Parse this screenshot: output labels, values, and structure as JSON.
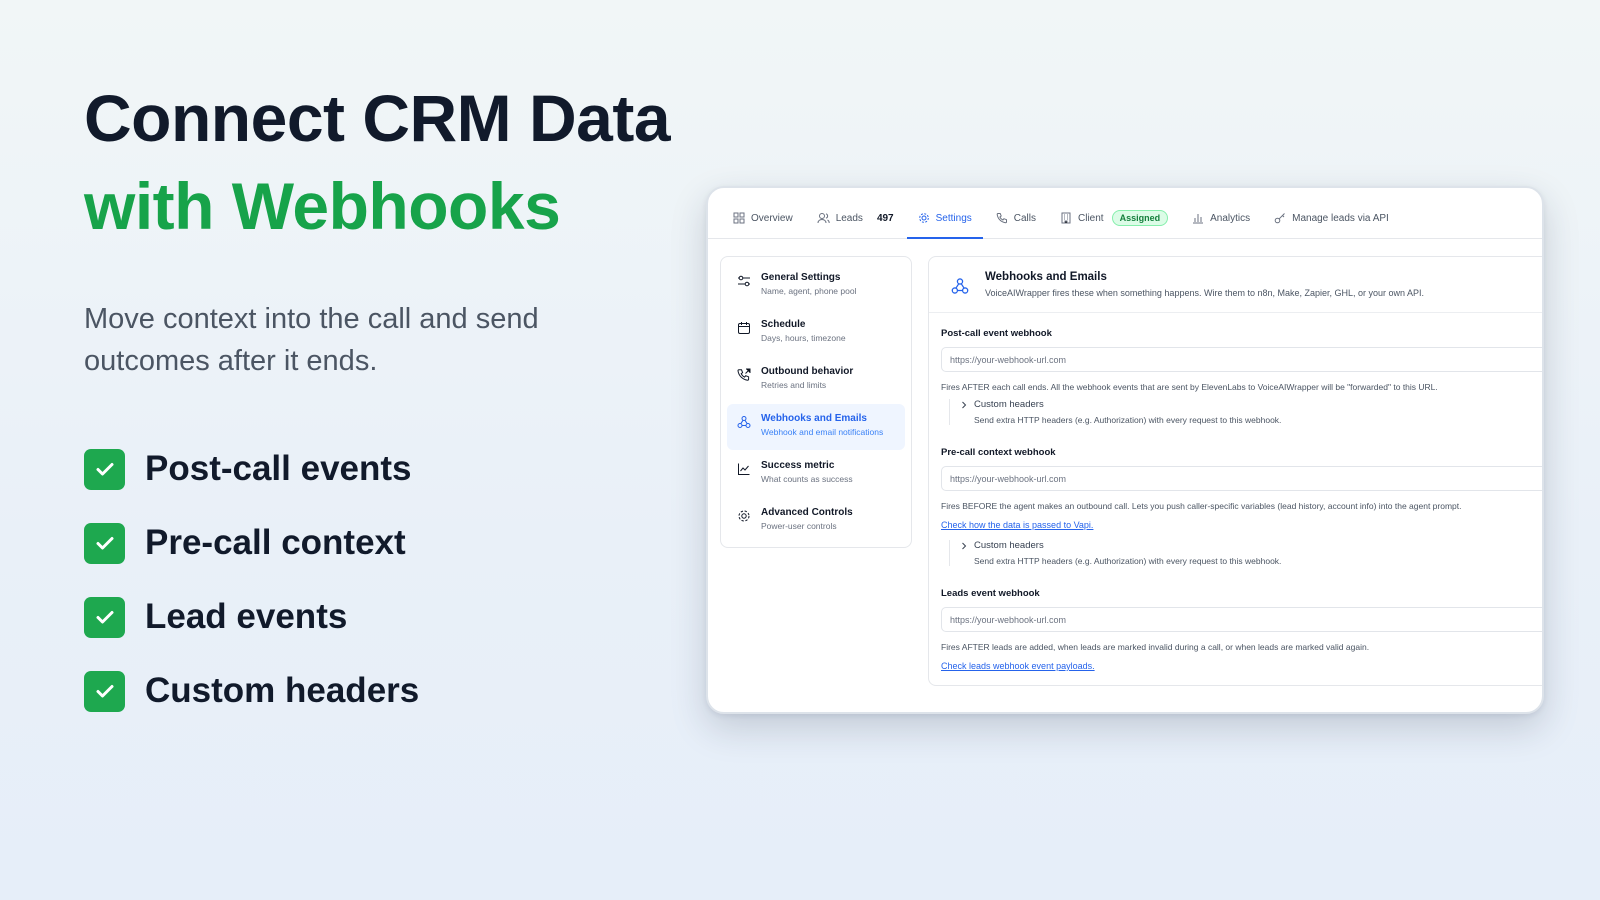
{
  "hero": {
    "title_line1": "Connect CRM Data",
    "title_line2": "with Webhooks",
    "subtitle": "Move context into the call and send outcomes after it ends.",
    "features": [
      {
        "label": "Post-call events"
      },
      {
        "label": "Pre-call context"
      },
      {
        "label": "Lead events"
      },
      {
        "label": "Custom headers"
      }
    ]
  },
  "colors": {
    "accent_green": "#17a34a",
    "check_green": "#1ea84f",
    "primary_blue": "#2563eb",
    "ink": "#111a2b"
  },
  "tabs": [
    {
      "label": "Overview",
      "icon": "grid-icon"
    },
    {
      "label": "Leads",
      "icon": "users-icon",
      "count": "497"
    },
    {
      "label": "Settings",
      "icon": "gear-icon",
      "active": true
    },
    {
      "label": "Calls",
      "icon": "phone-icon"
    },
    {
      "label": "Client",
      "icon": "building-icon",
      "badge": "Assigned"
    },
    {
      "label": "Analytics",
      "icon": "bar-chart-icon"
    },
    {
      "label": "Manage leads via API",
      "icon": "key-icon"
    }
  ],
  "sidebar": {
    "items": [
      {
        "title": "General Settings",
        "desc": "Name, agent, phone pool",
        "icon": "sliders-icon"
      },
      {
        "title": "Schedule",
        "desc": "Days, hours, timezone",
        "icon": "calendar-icon"
      },
      {
        "title": "Outbound behavior",
        "desc": "Retries and limits",
        "icon": "phone-outgoing-icon"
      },
      {
        "title": "Webhooks and Emails",
        "desc": "Webhook and email notifications",
        "icon": "webhook-icon",
        "active": true
      },
      {
        "title": "Success metric",
        "desc": "What counts as success",
        "icon": "line-chart-icon"
      },
      {
        "title": "Advanced Controls",
        "desc": "Power-user controls",
        "icon": "cog-icon"
      }
    ]
  },
  "panel": {
    "title": "Webhooks and Emails",
    "desc": "VoiceAIWrapper fires these when something happens. Wire them to n8n, Make, Zapier, GHL, or your own API.",
    "post_call": {
      "label": "Post-call event webhook",
      "placeholder": "https://your-webhook-url.com",
      "help": "Fires AFTER each call ends. All the webhook events that are sent by ElevenLabs to VoiceAIWrapper will be \"forwarded\" to this URL.",
      "headers_title": "Custom headers",
      "headers_desc": "Send extra HTTP headers (e.g. Authorization) with every request to this webhook."
    },
    "pre_call": {
      "label": "Pre-call context webhook",
      "placeholder": "https://your-webhook-url.com",
      "help": "Fires BEFORE the agent makes an outbound call. Lets you push caller-specific variables (lead history, account info) into the agent prompt.",
      "link": "Check how the data is passed to Vapi.",
      "headers_title": "Custom headers",
      "headers_desc": "Send extra HTTP headers (e.g. Authorization) with every request to this webhook."
    },
    "leads": {
      "label": "Leads event webhook",
      "placeholder": "https://your-webhook-url.com",
      "help": "Fires AFTER leads are added, when leads are marked invalid during a call, or when leads are marked valid again.",
      "link": "Check leads webhook event payloads."
    }
  }
}
